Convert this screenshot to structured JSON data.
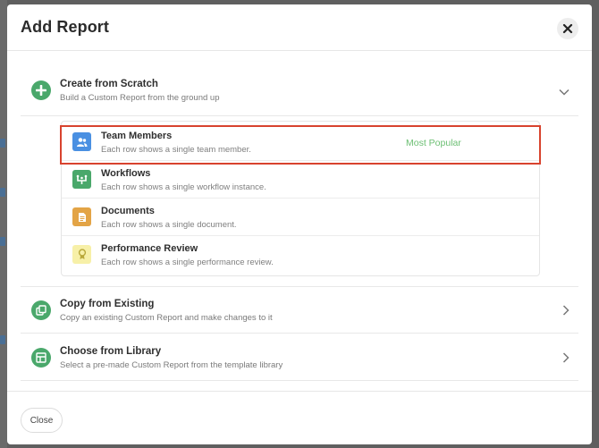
{
  "modal": {
    "title": "Add Report",
    "close_icon": "close-icon"
  },
  "options": [
    {
      "title": "Create from Scratch",
      "subtitle": "Build a Custom Report from the ground up",
      "icon": "plus-circle-icon",
      "state": "expanded"
    },
    {
      "title": "Copy from Existing",
      "subtitle": "Copy an existing Custom Report and make changes to it",
      "icon": "copy-icon",
      "state": "collapsed"
    },
    {
      "title": "Choose from Library",
      "subtitle": "Select a pre-made Custom Report from the template library",
      "icon": "library-icon",
      "state": "collapsed"
    }
  ],
  "report_types": [
    {
      "title": "Team Members",
      "description": "Each row shows a single team member.",
      "icon": "team-members-icon",
      "icon_color": "#4a90e2",
      "badge": "Most Popular",
      "selected": true
    },
    {
      "title": "Workflows",
      "description": "Each row shows a single workflow instance.",
      "icon": "workflow-icon",
      "icon_color": "#4aa86b"
    },
    {
      "title": "Documents",
      "description": "Each row shows a single document.",
      "icon": "document-icon",
      "icon_color": "#e3a446"
    },
    {
      "title": "Performance Review",
      "description": "Each row shows a single performance review.",
      "icon": "award-icon",
      "icon_color": "#f7f0a8"
    }
  ],
  "footer": {
    "close_label": "Close"
  },
  "colors": {
    "accent_green": "#4aa86b",
    "selection_red": "#d8432e",
    "badge_green": "#6cbf73"
  }
}
